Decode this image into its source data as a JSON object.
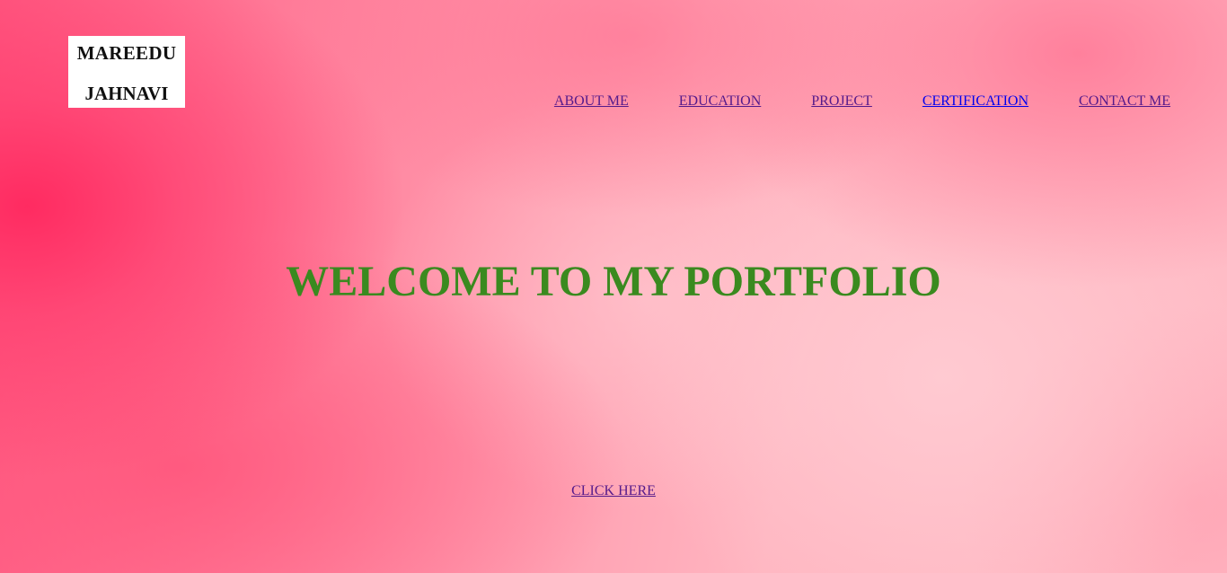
{
  "header": {
    "logo": {
      "line1": "MAREEDU",
      "line2": "JAHNAVI"
    },
    "nav": [
      {
        "label": "ABOUT ME"
      },
      {
        "label": "EDUCATION"
      },
      {
        "label": "PROJECT"
      },
      {
        "label": "CERTIFICATION"
      },
      {
        "label": "CONTACT ME"
      }
    ]
  },
  "hero": {
    "title": "WELCOME TO MY PORTFOLIO",
    "cta_label": "CLICK HERE"
  },
  "colors": {
    "title": "#3a8a1f",
    "visited_link": "#551a8b",
    "link": "#0000ee",
    "background_accent": "#ff5a82"
  }
}
